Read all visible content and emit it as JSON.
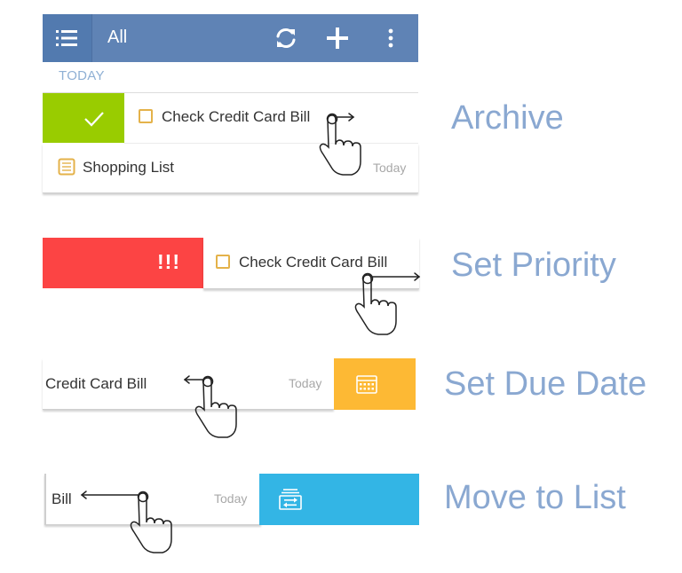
{
  "app_bar": {
    "title": "All",
    "icons": [
      "list-menu-icon",
      "sync-icon",
      "add-icon",
      "overflow-menu-icon"
    ]
  },
  "section": {
    "label": "TODAY"
  },
  "tasks": {
    "credit_card": "Check Credit Card Bill",
    "shopping": "Shopping List",
    "due_today": "Today"
  },
  "panels": {
    "archive": {
      "caption": "Archive",
      "swipe_color": "#99cc00",
      "icon": "check-icon"
    },
    "priority": {
      "caption": "Set Priority",
      "swipe_color": "#fc4444",
      "badge": "!!!"
    },
    "due_date": {
      "caption": "Set Due Date",
      "swipe_color": "#fdb934",
      "partial_text": "Credit Card Bill",
      "date": "Today",
      "icon": "calendar-icon"
    },
    "move_list": {
      "caption": "Move to List",
      "swipe_color": "#33b5e5",
      "partial_text": "Bill",
      "date": "Today",
      "icon": "list-move-icon"
    }
  },
  "colors": {
    "appbar": "#5f83b5",
    "caption": "#8aa8d1",
    "checkbox": "#e4b24a"
  }
}
